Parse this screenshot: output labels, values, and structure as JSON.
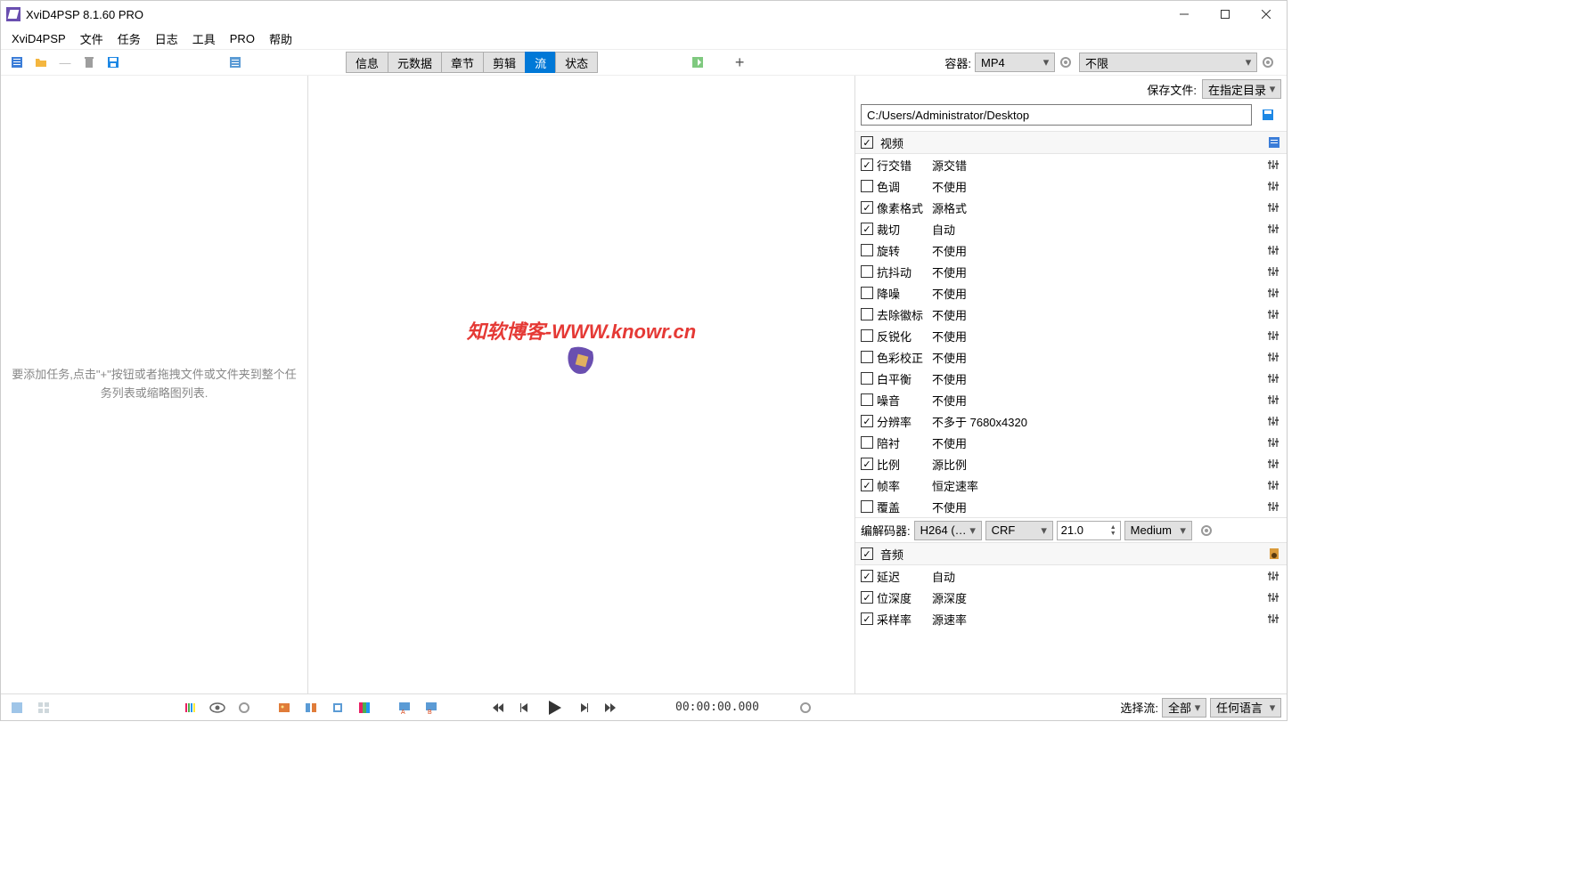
{
  "title": "XviD4PSP 8.1.60 PRO",
  "menu": {
    "items": [
      "XviD4PSP",
      "文件",
      "任务",
      "日志",
      "工具",
      "PRO",
      "帮助"
    ]
  },
  "tabs": {
    "items": [
      "信息",
      "元数据",
      "章节",
      "剪辑",
      "流",
      "状态"
    ],
    "active": 4
  },
  "top": {
    "container_label": "容器:",
    "container_value": "MP4",
    "limit_value": "不限"
  },
  "save": {
    "label": "保存文件:",
    "mode": "在指定目录",
    "path": "C:/Users/Administrator/Desktop"
  },
  "left_hint": "要添加任务,点击\"+\"按钮或者拖拽文件或文件夹到整个任务列表或缩略图列表.",
  "watermark": "知软博客-WWW.knowr.cn",
  "video_section": {
    "title": "视频"
  },
  "video_props": [
    {
      "checked": true,
      "name": "行交错",
      "value": "源交错"
    },
    {
      "checked": false,
      "name": "色调",
      "value": "不使用"
    },
    {
      "checked": true,
      "name": "像素格式",
      "value": "源格式"
    },
    {
      "checked": true,
      "name": "裁切",
      "value": "自动"
    },
    {
      "checked": false,
      "name": "旋转",
      "value": "不使用"
    },
    {
      "checked": false,
      "name": "抗抖动",
      "value": "不使用"
    },
    {
      "checked": false,
      "name": "降噪",
      "value": "不使用"
    },
    {
      "checked": false,
      "name": "去除徽标",
      "value": "不使用"
    },
    {
      "checked": false,
      "name": "反锐化",
      "value": "不使用"
    },
    {
      "checked": false,
      "name": "色彩校正",
      "value": "不使用"
    },
    {
      "checked": false,
      "name": "白平衡",
      "value": "不使用"
    },
    {
      "checked": false,
      "name": "噪音",
      "value": "不使用"
    },
    {
      "checked": true,
      "name": "分辨率",
      "value": "不多于 7680x4320"
    },
    {
      "checked": false,
      "name": "陪衬",
      "value": "不使用"
    },
    {
      "checked": true,
      "name": "比例",
      "value": "源比例"
    },
    {
      "checked": true,
      "name": "帧率",
      "value": "恒定速率"
    },
    {
      "checked": false,
      "name": "覆盖",
      "value": "不使用"
    }
  ],
  "encoder": {
    "label": "编解码器:",
    "codec": "H264 (…",
    "mode": "CRF",
    "value": "21.0",
    "preset": "Medium"
  },
  "audio_section": {
    "title": "音频"
  },
  "audio_props": [
    {
      "checked": true,
      "name": "延迟",
      "value": "自动"
    },
    {
      "checked": true,
      "name": "位深度",
      "value": "源深度"
    },
    {
      "checked": true,
      "name": "采样率",
      "value": "源速率"
    }
  ],
  "status": {
    "time": "00:00:00.000",
    "stream_label": "选择流:",
    "stream_sel": "全部",
    "lang_sel": "任何语言"
  }
}
